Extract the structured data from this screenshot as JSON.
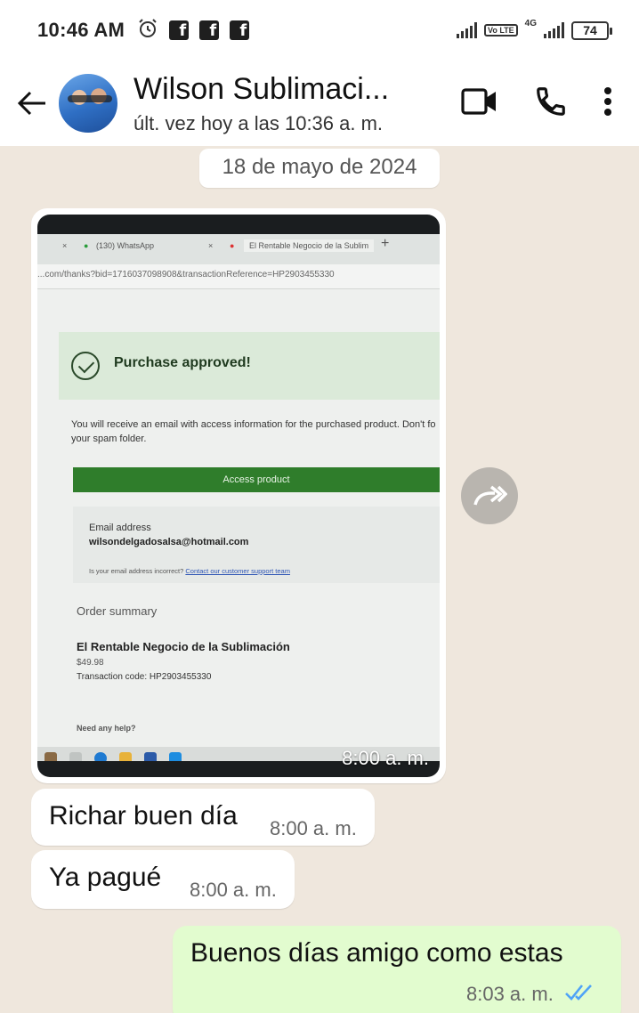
{
  "status_bar": {
    "time": "10:46 AM",
    "notification_icons": [
      "alarm-icon",
      "facebook-icon",
      "facebook-icon",
      "facebook-icon"
    ],
    "network_label": "4G",
    "volte_label": "Vo LTE",
    "battery": "74"
  },
  "header": {
    "contact_name": "Wilson Sublimaci...",
    "last_seen": "últ. vez hoy a las 10:36 a. m.",
    "icons": [
      "back-arrow-icon",
      "video-call-icon",
      "phone-call-icon",
      "more-options-icon"
    ]
  },
  "date_chip": "18 de mayo de 2024",
  "image_message": {
    "time": "8:00 a. m.",
    "screenshot": {
      "tab_1": "(130) WhatsApp",
      "tab_2": "El Rentable Negocio de la Sublim",
      "url": "...com/thanks?bid=1716037098908&transactionReference=HP2903455330",
      "heading": "Purchase approved!",
      "info": "You will receive an email with access information for the purchased product. Don't fo",
      "info_line2": "your spam folder.",
      "button": "Access product",
      "email_label": "Email address",
      "email_value": "wilsondelgadosalsa@hotmail.com",
      "email_note": "Is your email address incorrect?",
      "email_link": "Contact our customer support team",
      "order_summary": "Order summary",
      "product_name": "El Rentable Negocio de la Sublimación",
      "price": "$49.98",
      "transaction": "Transaction code: HP2903455330",
      "help": "Need any help?"
    }
  },
  "messages": [
    {
      "direction": "incoming",
      "text": "Richar buen día",
      "time": "8:00 a. m."
    },
    {
      "direction": "incoming",
      "text": "Ya pagué",
      "time": "8:00 a. m."
    },
    {
      "direction": "outgoing",
      "text": "Buenos días amigo como estas",
      "time": "8:03 a. m.",
      "status": "read"
    }
  ],
  "colors": {
    "chat_background": "#efe7dd",
    "outgoing_bubble": "#e2fccf",
    "incoming_bubble": "#ffffff",
    "read_ticks": "#4fa3f7",
    "approved_green": "#2f7d2b"
  }
}
